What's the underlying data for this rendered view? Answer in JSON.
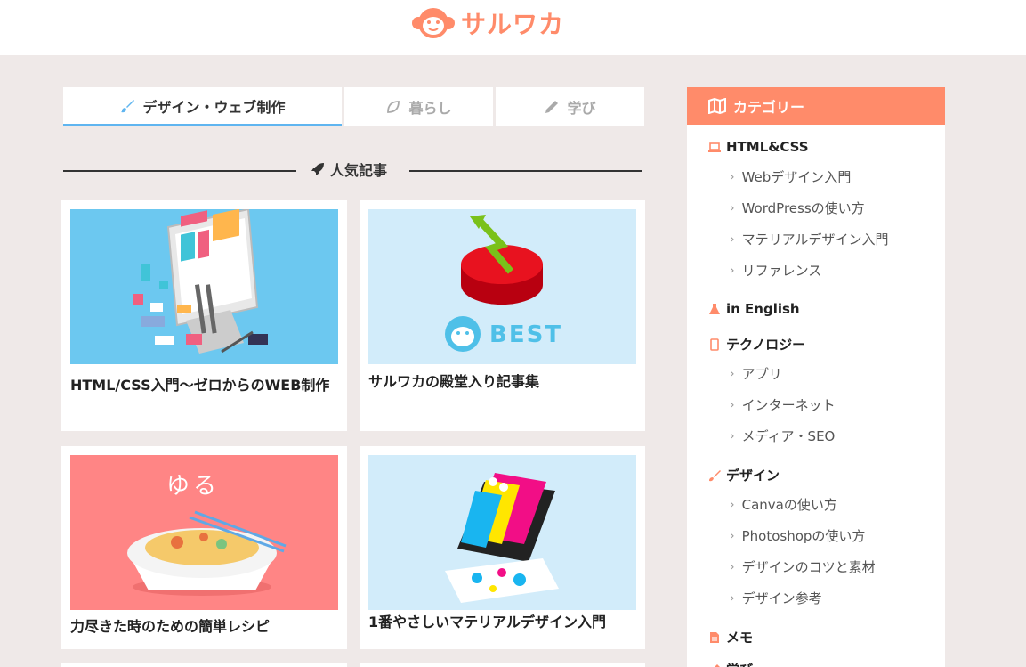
{
  "site": {
    "logo_text": "サルワカ"
  },
  "colors": {
    "accent": "#ff8b6a",
    "tab_active": "#5fb5f0",
    "background": "#efe9e8"
  },
  "tabs": [
    {
      "label": "デザイン・ウェブ制作",
      "icon": "brush-icon",
      "active": true
    },
    {
      "label": "暮らし",
      "icon": "leaf-icon",
      "active": false
    },
    {
      "label": "学び",
      "icon": "pencil-icon",
      "active": false
    }
  ],
  "section": {
    "title": "人気記事",
    "icon": "rocket-icon"
  },
  "articles": [
    {
      "title": "HTML/CSS入門〜ゼロからのWEB制作"
    },
    {
      "title": "サルワカの殿堂入り記事集",
      "badge": "BEST"
    },
    {
      "title": "力尽きた時のための簡単レシピ",
      "thumb_text": "ゆる"
    },
    {
      "title": "1番やさしいマテリアルデザイン入門"
    }
  ],
  "sidebar": {
    "title": "カテゴリー",
    "categories": [
      {
        "label": "HTML&CSS",
        "icon": "laptop-icon",
        "subs": [
          "Webデザイン入門",
          "WordPressの使い方",
          "マテリアルデザイン入門",
          "リファレンス"
        ]
      },
      {
        "label": "in English",
        "icon": "flask-icon",
        "subs": []
      },
      {
        "label": "テクノロジー",
        "icon": "tablet-icon",
        "subs": [
          "アプリ",
          "インターネット",
          "メディア・SEO"
        ]
      },
      {
        "label": "デザイン",
        "icon": "brush-icon",
        "subs": [
          "Canvaの使い方",
          "Photoshopの使い方",
          "デザインのコツと素材",
          "デザイン参考"
        ]
      },
      {
        "label": "メモ",
        "icon": "document-icon",
        "subs": []
      },
      {
        "label": "学び",
        "icon": "pencil-icon",
        "subs": []
      }
    ]
  }
}
